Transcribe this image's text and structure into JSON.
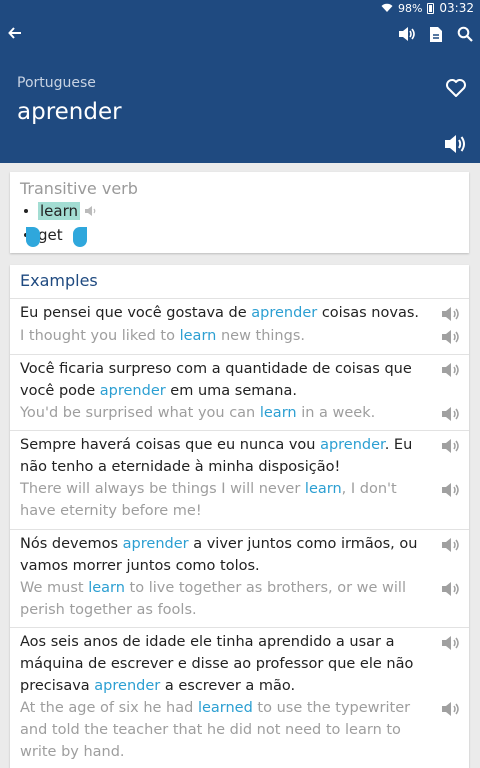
{
  "statusbar": {
    "battery": "98%",
    "time": "03:32"
  },
  "header": {
    "back_icon": "arrow-left-icon",
    "language": "Portuguese",
    "word": "aprender"
  },
  "definition": {
    "part_of_speech": "Transitive verb",
    "translations": [
      {
        "text": "learn",
        "selected": true
      },
      {
        "text": "get",
        "selected": false
      }
    ]
  },
  "examples": {
    "title": "Examples",
    "items": [
      {
        "pt": [
          "Eu pensei que você gostava de ",
          "aprender",
          " coisas novas."
        ],
        "en": [
          "I thought you liked to ",
          "learn",
          " new things."
        ]
      },
      {
        "pt": [
          "Você ficaria surpreso com a quantidade de coisas que você pode ",
          "aprender",
          " em uma semana."
        ],
        "en": [
          "You'd be surprised what you can ",
          "learn",
          " in a week."
        ]
      },
      {
        "pt": [
          "Sempre haverá coisas que eu nunca vou ",
          "aprender",
          ". Eu não tenho a eternidade à minha disposição!"
        ],
        "en": [
          "There will always be things I will never ",
          "learn",
          ", I don't have eternity before me!"
        ]
      },
      {
        "pt": [
          "Nós devemos ",
          "aprender",
          " a viver juntos como irmãos, ou vamos morrer juntos como tolos."
        ],
        "en": [
          "We must ",
          "learn",
          " to live together as brothers, or we will perish together as fools."
        ]
      },
      {
        "pt": [
          "Aos seis anos de idade ele tinha aprendido a usar a máquina de escrever e disse ao professor que ele não precisava ",
          "aprender",
          " a escrever a mão."
        ],
        "en": [
          "At the age of six he had ",
          "learned",
          " to use the typewriter and told the teacher that he did not need to learn to write by hand."
        ]
      }
    ]
  },
  "colors": {
    "primary": "#1f4a80",
    "accent": "#2c9fd2",
    "highlight": "#a3ddd3"
  }
}
